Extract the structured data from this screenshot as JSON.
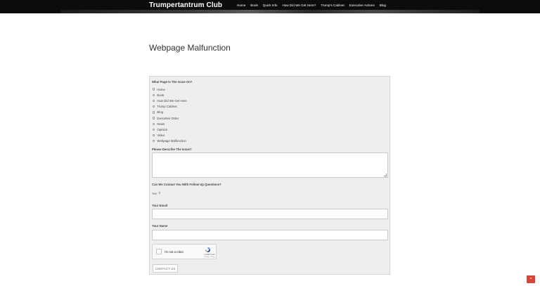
{
  "header": {
    "brand": "Trumpertantrum Club",
    "nav": [
      "Home",
      "Book",
      "Quick Info",
      "How Did We Get Here?",
      "Trump's Cabinet",
      "Executive Actions",
      "Blog"
    ]
  },
  "page": {
    "title": "Webpage Malfunction"
  },
  "form": {
    "issue_page_label": "What Page Is The Issue On?",
    "pages": [
      "Home",
      "Book",
      "How Did We Get Here",
      "Trump Cabinet",
      "Blog",
      "Executive Order",
      "News",
      "Opinion",
      "Video",
      "Webpage Malfunction"
    ],
    "describe_label": "Please Describe The Issue?",
    "contact_label": "Can We Contact You With Follow Up Questions?",
    "contact_value": "Yes",
    "email_label": "Your Email",
    "name_label": "Your Name",
    "captcha_text": "I'm not a robot",
    "captcha_brand": "reCAPTCHA",
    "captcha_links": "Privacy - Terms",
    "submit_label": "CONTACT US"
  },
  "scroll_top_icon": "chevron-up-icon",
  "colors": {
    "accent": "#d9433a",
    "header_bg": "#0c0c0c"
  }
}
